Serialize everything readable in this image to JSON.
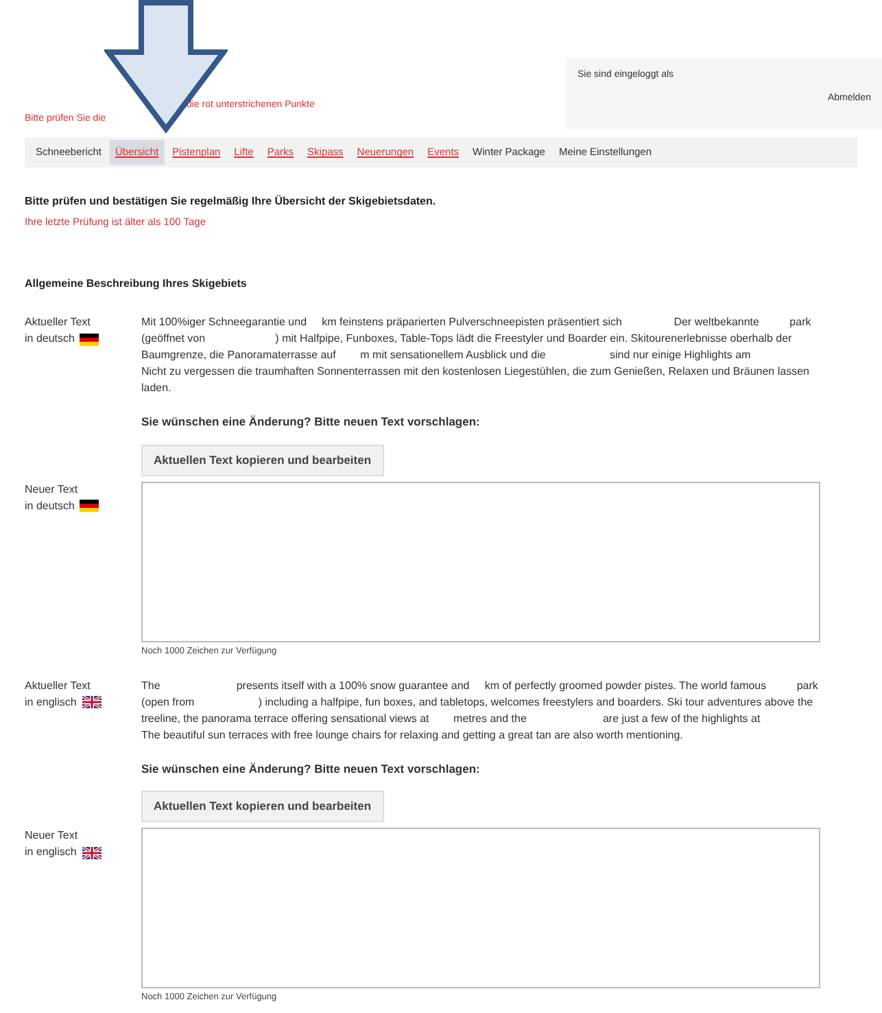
{
  "notice": [
    "Bitte prüfen Sie die",
    "die rot unterstrichenen Punkte"
  ],
  "login": {
    "text": "Sie sind eingeloggt als",
    "logout": "Abmelden"
  },
  "tabs": [
    {
      "label": "Schneebericht",
      "selected": false,
      "incomplete": false
    },
    {
      "label": "Übersicht",
      "selected": true,
      "incomplete": true
    },
    {
      "label": "Pistenplan",
      "selected": false,
      "incomplete": true
    },
    {
      "label": "Lifte",
      "selected": false,
      "incomplete": true
    },
    {
      "label": "Parks",
      "selected": false,
      "incomplete": true
    },
    {
      "label": "Skipass",
      "selected": false,
      "incomplete": true
    },
    {
      "label": "Neuerungen",
      "selected": false,
      "incomplete": true
    },
    {
      "label": "Events",
      "selected": false,
      "incomplete": true
    },
    {
      "label": "Winter Package",
      "selected": false,
      "incomplete": false
    },
    {
      "label": "Meine Einstellungen",
      "selected": false,
      "incomplete": false
    }
  ],
  "intro": "Bitte prüfen und bestätigen Sie regelmäßig Ihre Übersicht der Skigebietsdaten.",
  "warning": "Ihre letzte Prüfung ist älter als 100 Tage",
  "section_title": "Allgemeine Beschreibung Ihres Skigebiets",
  "languages": [
    {
      "kind": "de",
      "current_label": "Aktueller Text",
      "current_lang": "in deutsch",
      "current_text": "Mit 100%iger Schneegarantie und     km feinstens präparierten Pulverschneepisten präsentiert sich                 Der weltbekannte          park (geöffnet von                       ) mit Halfpipe, Funboxes, Table-Tops lädt die Freestyler und Boarder ein. Skitourenerlebnisse oberhalb der Baumgrenze, die Panoramaterrasse auf        m mit sensationellem Ausblick und die                     sind nur einige Highlights am                          Nicht zu vergessen die traumhaften Sonnenterrassen mit den kostenlosen Liegestühlen, die zum Genießen, Relaxen und Bräunen lassen laden.",
      "prompt": "Sie wünschen eine Änderung? Bitte neuen Text vorschlagen:",
      "copy_button": "Aktuellen Text kopieren und bearbeiten",
      "new_label": "Neuer Text",
      "new_lang": "in deutsch",
      "counter": "Noch 1000 Zeichen zur Verfügung"
    },
    {
      "kind": "en",
      "current_label": "Aktueller Text",
      "current_lang": "in englisch",
      "current_text": "The                         presents itself with a 100% snow guarantee and     km of perfectly groomed powder pistes. The world famous          park (open from                     ) including a halfpipe, fun boxes, and tabletops, welcomes freestylers and boarders. Ski tour adventures above the treeline, the panorama terrace offering sensational views at        metres and the                         are just a few of the highlights at                       The beautiful sun terraces with free lounge chairs for relaxing and getting a great tan are also worth mentioning.",
      "prompt": "Sie wünschen eine Änderung? Bitte neuen Text vorschlagen:",
      "copy_button": "Aktuellen Text kopieren und bearbeiten",
      "new_label": "Neuer Text",
      "new_lang": "in englisch",
      "counter": "Noch 1000 Zeichen zur Verfügung"
    }
  ]
}
